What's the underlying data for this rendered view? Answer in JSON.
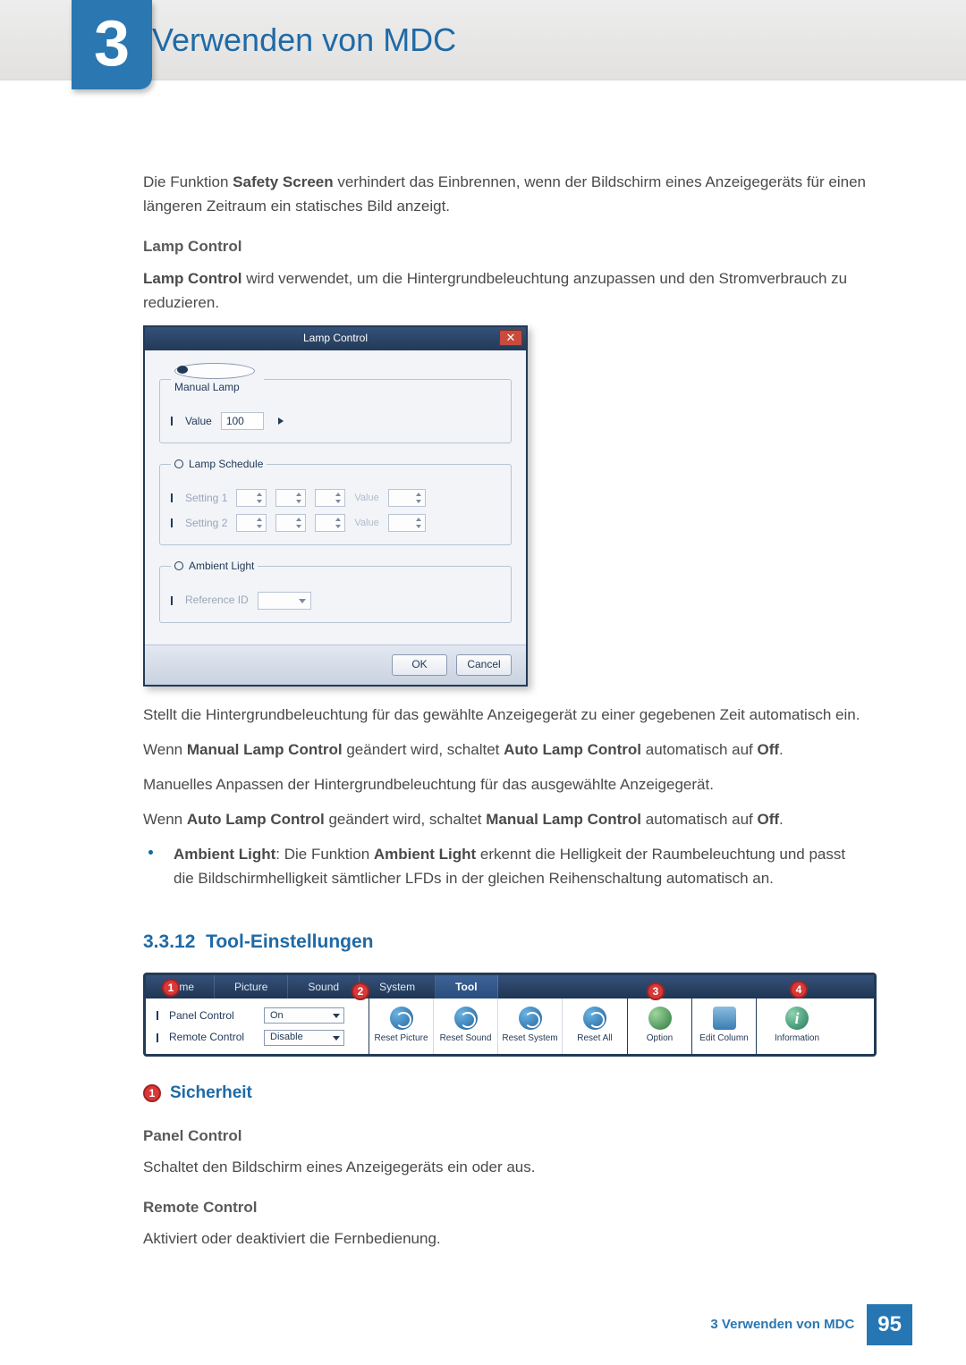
{
  "header": {
    "chapter_number": "3",
    "title": "Verwenden von MDC"
  },
  "intro": {
    "text_pre": "Die Funktion ",
    "safety_screen": "Safety Screen",
    "text_post": " verhindert das Einbrennen, wenn der Bildschirm eines Anzeigegeräts für einen längeren Zeitraum ein statisches Bild anzeigt."
  },
  "lamp_control": {
    "subhead": "Lamp Control",
    "para_pre": "Lamp Control",
    "para_post": " wird verwendet, um die Hintergrundbeleuchtung anzupassen und den Stromverbrauch zu reduzieren."
  },
  "dialog": {
    "title": "Lamp Control",
    "manual_legend": "Manual Lamp",
    "value_label": "Value",
    "value": "100",
    "schedule_legend": "Lamp Schedule",
    "setting1": "Setting 1",
    "setting2": "Setting 2",
    "val_hint": "Value",
    "ambient_legend": "Ambient Light",
    "reference_label": "Reference ID",
    "ok": "OK",
    "cancel": "Cancel"
  },
  "after_dialog": {
    "p1": "Stellt die Hintergrundbeleuchtung für das gewählte Anzeigegerät zu einer gegebenen Zeit automatisch ein.",
    "p2a": "Wenn ",
    "p2b": "Manual Lamp Control",
    "p2c": " geändert wird, schaltet ",
    "p2d": "Auto Lamp Control",
    "p2e": " automatisch auf ",
    "p2f": "Off",
    "p2g": ".",
    "p3": "Manuelles Anpassen der Hintergrundbeleuchtung für das ausgewählte Anzeigegerät.",
    "p4a": "Wenn ",
    "p4b": "Auto Lamp Control",
    "p4c": " geändert wird, schaltet ",
    "p4d": "Manual Lamp Control",
    "p4e": " automatisch auf ",
    "p4f": "Off",
    "p4g": ".",
    "bullet_a": "Ambient Light",
    "bullet_b": ": Die Funktion ",
    "bullet_c": "Ambient Light",
    "bullet_d": " erkennt die Helligkeit der Raumbeleuchtung und passt die Bildschirmhelligkeit sämtlicher LFDs in der gleichen Reihenschaltung automatisch an."
  },
  "section": {
    "num": "3.3.12",
    "title": "Tool-Einstellungen"
  },
  "toolbar": {
    "tabs": [
      "Home",
      "Picture",
      "Sound",
      "System",
      "Tool"
    ],
    "panel_control_label": "Panel Control",
    "panel_control_value": "On",
    "remote_control_label": "Remote Control",
    "remote_control_value": "Disable",
    "reset_picture": "Reset Picture",
    "reset_sound": "Reset Sound",
    "reset_system": "Reset System",
    "reset_all": "Reset All",
    "option": "Option",
    "edit_column": "Edit Column",
    "information": "Information",
    "callouts": {
      "c1": "1",
      "c2": "2",
      "c3": "3",
      "c4": "4"
    }
  },
  "sicherheit": {
    "num": "1",
    "title": "Sicherheit",
    "panel_control_head": "Panel Control",
    "panel_control_text": "Schaltet den Bildschirm eines Anzeigegeräts ein oder aus.",
    "remote_control_head": "Remote Control",
    "remote_control_text": "Aktiviert oder deaktiviert die Fernbedienung."
  },
  "footer": {
    "text": "3 Verwenden von MDC",
    "page": "95"
  }
}
